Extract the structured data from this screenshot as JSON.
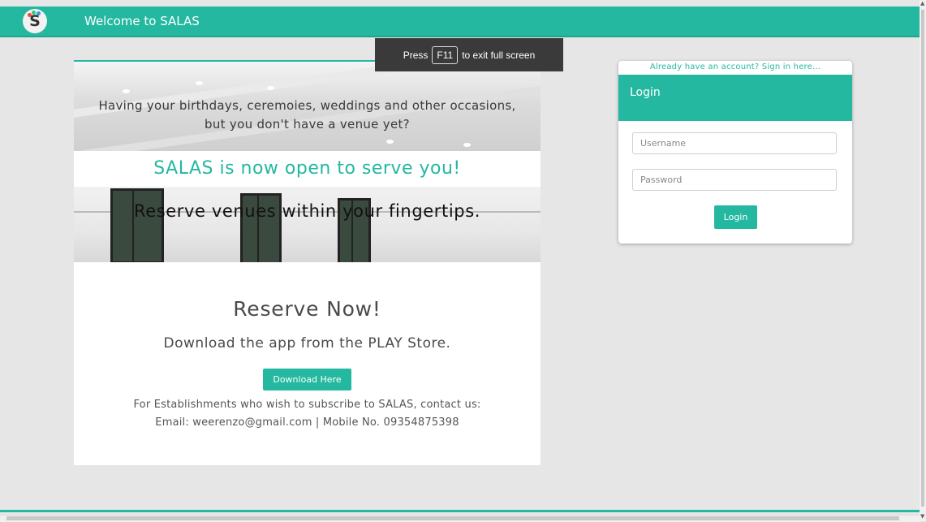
{
  "nav": {
    "title": "Welcome to SALAS",
    "logo_letter": "S"
  },
  "toast": {
    "press": "Press",
    "key": "F11",
    "suffix": "to exit full screen"
  },
  "hero": {
    "line1": "Having your birthdays, ceremoies, weddings and other occasions,",
    "line2": "but you don't have a venue yet?"
  },
  "banner": "SALAS is now open to serve you!",
  "hero2": {
    "text": "Reserve venues within your fingertips."
  },
  "reserve": {
    "title": "Reserve Now!",
    "subtitle": "Download the app from the PLAY Store.",
    "button": "Download Here",
    "contact_line1": "For Establishments who wish to subscribe to SALAS, contact us:",
    "contact_line2": "Email: weerenzo@gmail.com | Mobile No. 09354875398"
  },
  "login": {
    "signin_link": "Already have an account? Sign in here...",
    "title": "Login",
    "username_placeholder": "Username",
    "password_placeholder": "Password",
    "button": "Login"
  },
  "colors": {
    "accent": "#24b8a0",
    "background": "#e6e6e6"
  }
}
